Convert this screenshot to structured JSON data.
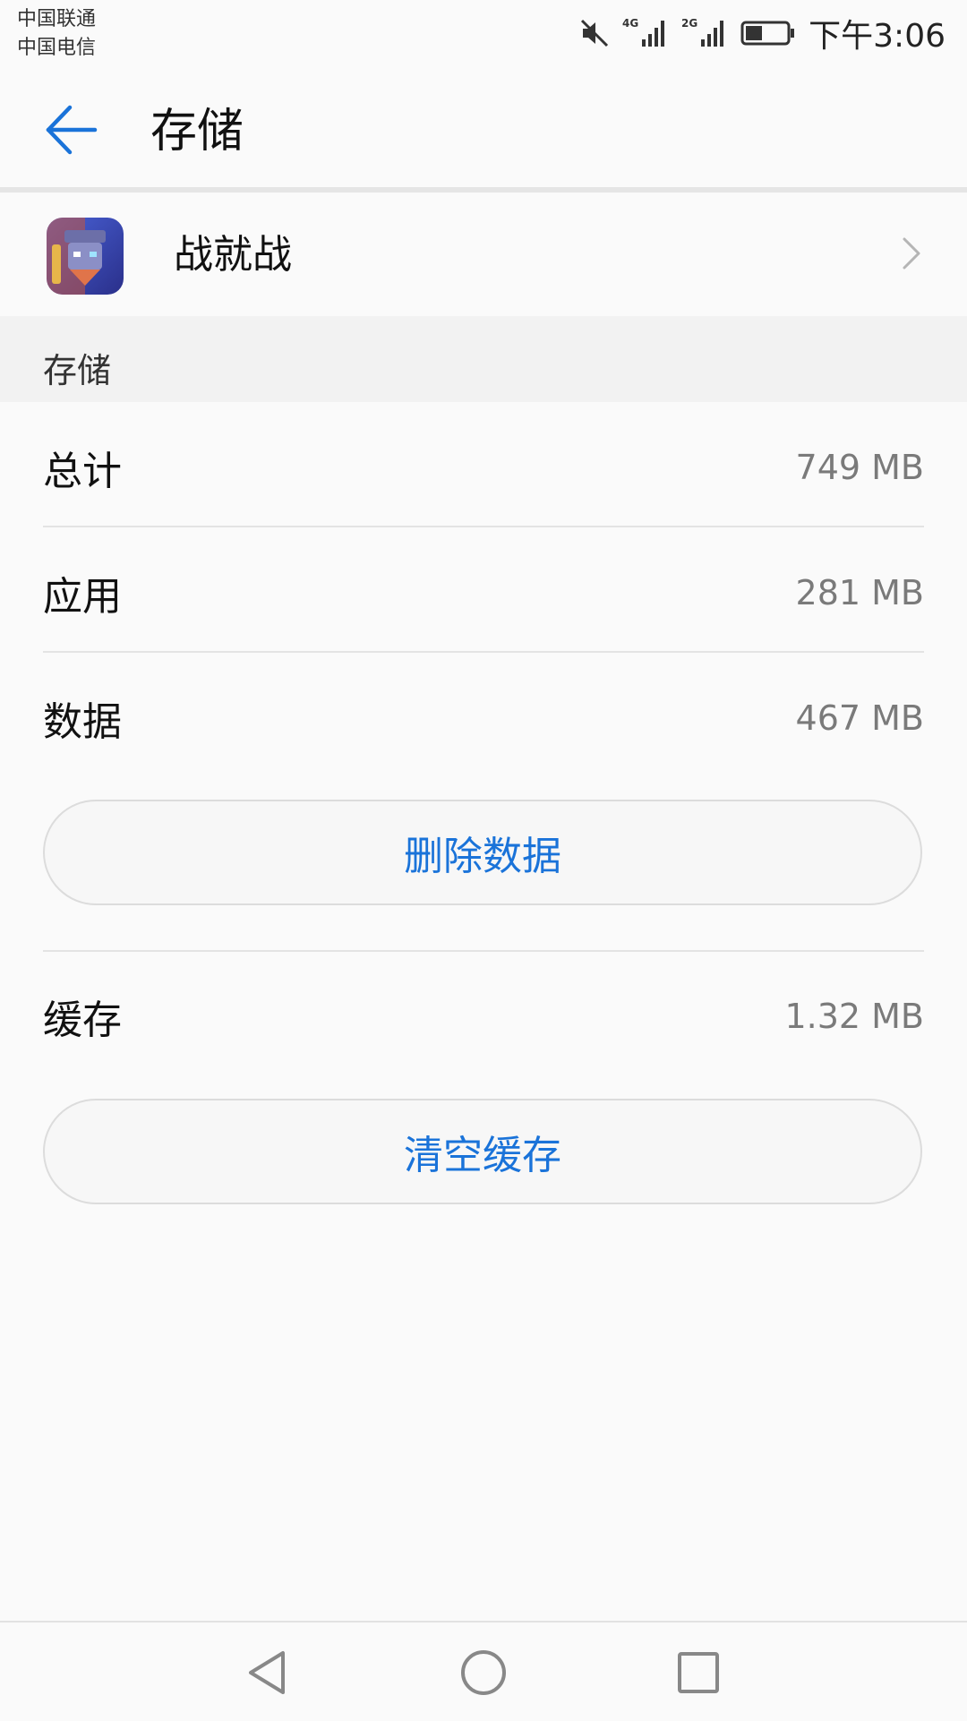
{
  "status_bar": {
    "carrier_1": "中国联通",
    "carrier_2": "中国电信",
    "time": "下午3:06",
    "icons": [
      "mute-icon",
      "signal-4g-icon",
      "signal-2g-icon",
      "battery-icon"
    ]
  },
  "header": {
    "title": "存储"
  },
  "app": {
    "name": "战就战"
  },
  "section": {
    "title": "存储"
  },
  "storage": {
    "total_label": "总计",
    "total_value": "749 MB",
    "app_label": "应用",
    "app_value": "281 MB",
    "data_label": "数据",
    "data_value": "467 MB",
    "delete_data_label": "删除数据",
    "cache_label": "缓存",
    "cache_value": "1.32 MB",
    "clear_cache_label": "清空缓存"
  },
  "colors": {
    "accent": "#1a73d9",
    "background": "#fafafa",
    "section_bg": "#f2f2f2",
    "value_text": "#7a7a7a"
  }
}
